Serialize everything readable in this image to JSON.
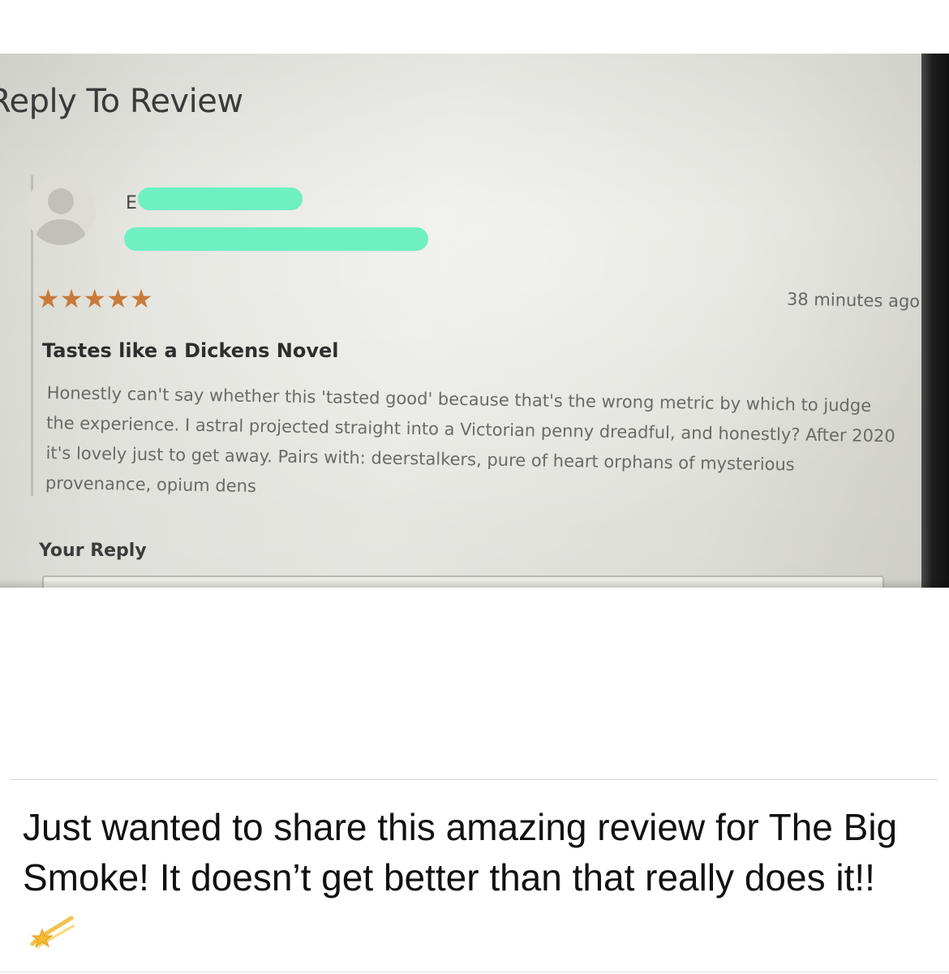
{
  "review_dialog": {
    "title": "Reply To Review",
    "reviewer": {
      "name_visible": "E",
      "avatar_icon": "user-avatar-icon"
    },
    "rating": {
      "stars": 5,
      "max": 5,
      "star_color": "#c97a3a"
    },
    "timestamp": "38 minutes ago",
    "review_title": "Tastes like a Dickens Novel",
    "review_body": "Honestly can't say whether this 'tasted good' because that's the wrong metric by which to judge the experience. I astral projected straight into a Victorian penny dreadful, and honestly? After 2020 it's lovely just to get away. Pairs with: deerstalkers, pure of heart orphans of mysterious provenance, opium dens",
    "reply_label": "Your Reply",
    "redaction_color": "#6ef0c3"
  },
  "post": {
    "caption": "Just wanted to share this amazing review for The Big Smoke! It doesn’t get better than that really does it!!",
    "caption_emoji": "dizzy-star-icon"
  }
}
